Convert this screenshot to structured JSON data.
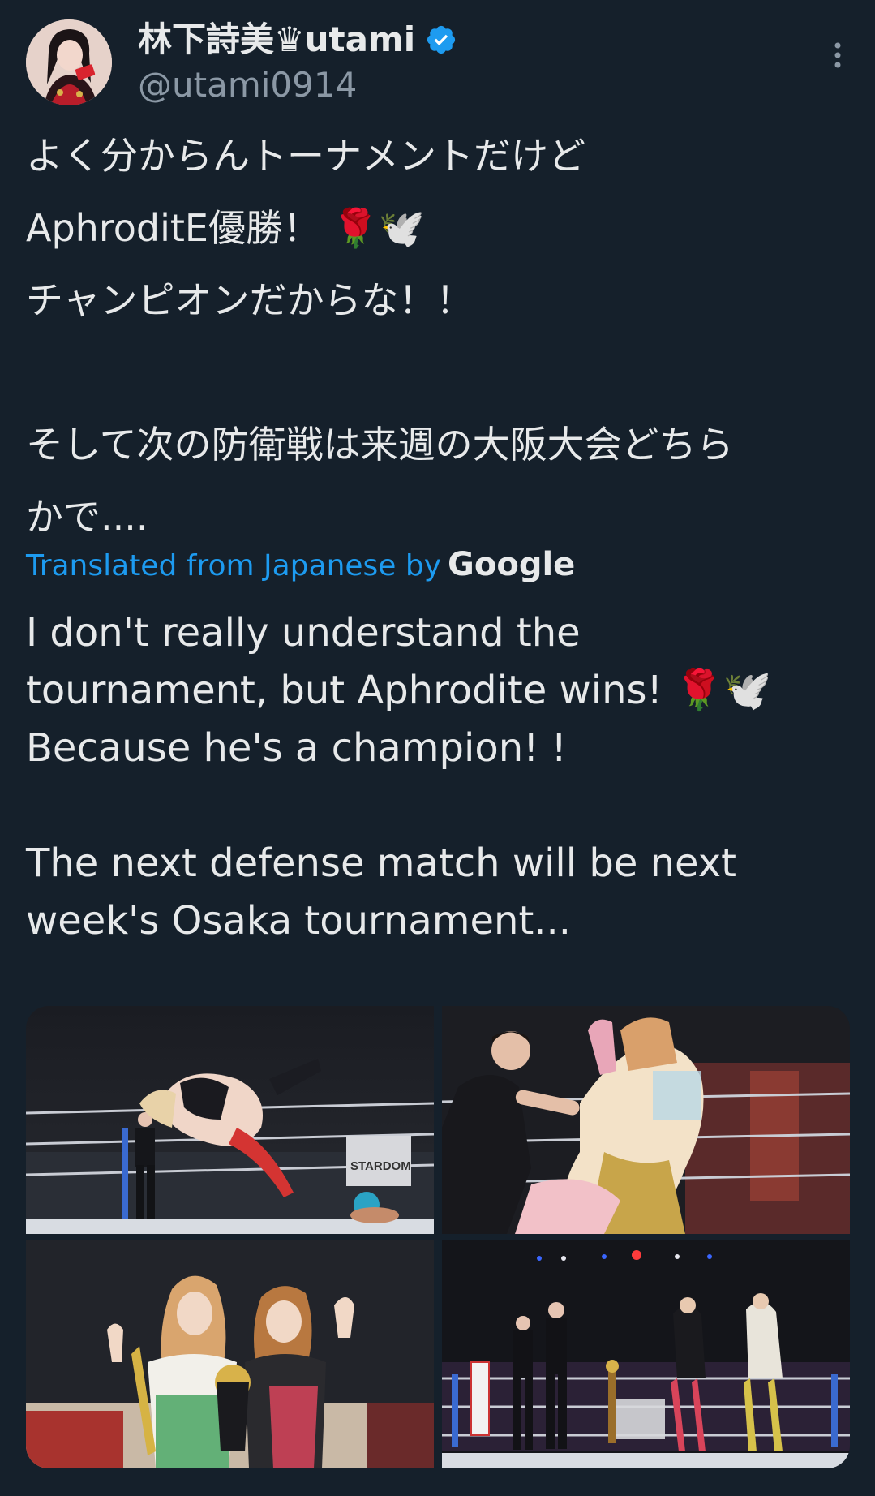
{
  "author": {
    "display_name": "林下詩美♛utami",
    "handle": "@utami0914",
    "verified": true,
    "verified_color": "#1d9bf0"
  },
  "tweet": {
    "original_lines": [
      "よく分からんトーナメントだけど",
      "AphroditE優勝！ 🌹🕊️",
      "チャンピオンだからな！！",
      "",
      "そして次の防衛戦は来週の大阪大会どちら",
      "かで...."
    ],
    "translation_label": "Translated from Japanese by",
    "translation_brand": "Google",
    "translated_lines": [
      "I don't really understand the",
      "tournament, but Aphrodite wins! 🌹🕊️",
      "Because he's a champion! !",
      "",
      "The next defense match will be next",
      "week's Osaka tournament..."
    ]
  },
  "media": {
    "count": 4,
    "photo_banner_text": "STARDOM"
  },
  "icons": [
    "avatar",
    "verified-badge-icon",
    "more-options-icon"
  ],
  "colors": {
    "background": "#15202b",
    "text": "#e7e9ea",
    "secondary_text": "#8b98a5",
    "link": "#1d9bf0"
  }
}
